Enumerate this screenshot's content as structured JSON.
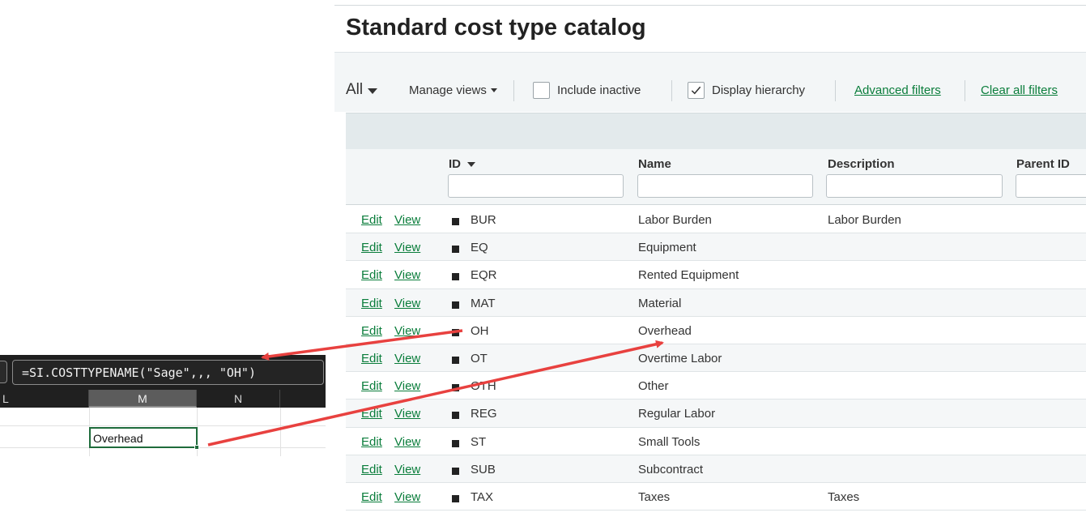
{
  "catalog": {
    "title": "Standard cost type catalog",
    "toolbar": {
      "view_label": "All",
      "manage_views": "Manage views",
      "include_inactive": "Include inactive",
      "include_inactive_checked": false,
      "display_hierarchy": "Display hierarchy",
      "display_hierarchy_checked": true,
      "advanced_filters": "Advanced filters",
      "clear_filters": "Clear all filters"
    },
    "columns": [
      "ID",
      "Name",
      "Description",
      "Parent ID"
    ],
    "row_actions": {
      "edit": "Edit",
      "view": "View"
    },
    "rows": [
      {
        "id": "BUR",
        "name": "Labor Burden",
        "description": "Labor Burden"
      },
      {
        "id": "EQ",
        "name": "Equipment",
        "description": ""
      },
      {
        "id": "EQR",
        "name": "Rented Equipment",
        "description": ""
      },
      {
        "id": "MAT",
        "name": "Material",
        "description": ""
      },
      {
        "id": "OH",
        "name": "Overhead",
        "description": ""
      },
      {
        "id": "OT",
        "name": "Overtime Labor",
        "description": ""
      },
      {
        "id": "OTH",
        "name": "Other",
        "description": ""
      },
      {
        "id": "REG",
        "name": "Regular Labor",
        "description": ""
      },
      {
        "id": "ST",
        "name": "Small Tools",
        "description": ""
      },
      {
        "id": "SUB",
        "name": "Subcontract",
        "description": ""
      },
      {
        "id": "TAX",
        "name": "Taxes",
        "description": "Taxes"
      }
    ],
    "link_color": "#0a7d3b"
  },
  "spreadsheet": {
    "formula": "=SI.COSTTYPENAME(\"Sage\",,, \"OH\")",
    "column_headers": [
      "L",
      "M",
      "N"
    ],
    "selected_column": "M",
    "active_cell_value": "Overhead",
    "accent": "#1e6b3b"
  },
  "annotation_color": "#e8413f"
}
